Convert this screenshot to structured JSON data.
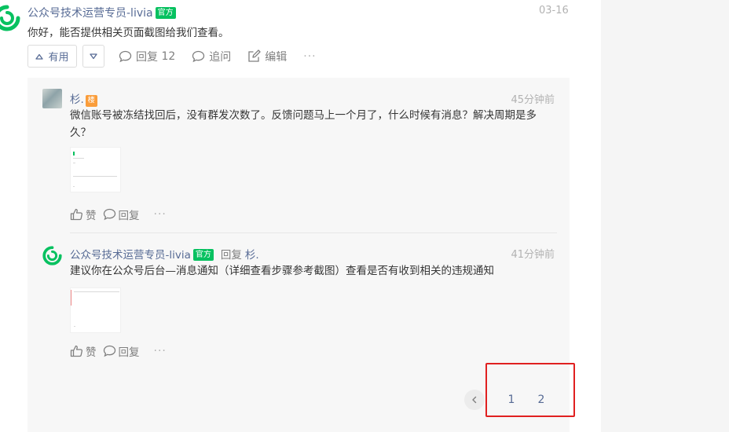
{
  "main_post": {
    "author": "公众号技术运营专员-livia",
    "badge": "官方",
    "time": "03-16",
    "content": "你好，能否提供相关页面截图给我们查看。",
    "avatar_icon": "wechat-logo-icon",
    "actions": {
      "useful_label": "有用",
      "reply_label": "回复",
      "reply_count": "12",
      "followup_label": "追问",
      "edit_label": "编辑",
      "more_label": "···"
    }
  },
  "replies": [
    {
      "author": "杉.",
      "floor_badge": "楼",
      "time": "45分钟前",
      "text": "微信账号被冻结找回后，没有群发次数了。反馈问题马上一个月了，什么时候有消息？解决周期是多久？",
      "like_label": "赞",
      "reply_label": "回复",
      "more_label": "···"
    },
    {
      "author": "公众号技术运营专员-livia",
      "badge": "官方",
      "reply_to_label": "回复",
      "reply_to_name": "杉.",
      "time": "41分钟前",
      "text": "建议你在公众号后台—消息通知（详细查看步骤参考截图）查看是否有收到相关的违规通知",
      "like_label": "赞",
      "reply_label": "回复",
      "more_label": "···"
    }
  ],
  "pagination": {
    "prev_icon": "chevron-left-icon",
    "pages": [
      "1",
      "2"
    ]
  },
  "colors": {
    "link": "#576b95",
    "official_badge": "#07c160",
    "floor_badge": "#fa9d3b",
    "highlight": "#e02020"
  }
}
